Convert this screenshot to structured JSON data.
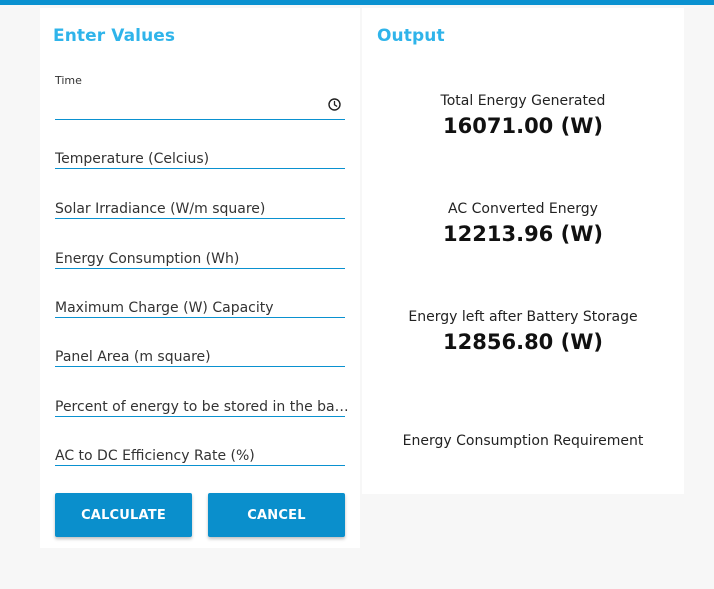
{
  "colors": {
    "accent": "#0a91d0",
    "title": "#2fb4ea",
    "background": "#f7f7f7",
    "card": "#ffffff"
  },
  "input_panel": {
    "title": "Enter Values",
    "time_label": "Time",
    "time_icon": "clock-icon",
    "fields": [
      "Temperature (Celcius)",
      "Solar Irradiance (W/m square)",
      "Energy Consumption (Wh)",
      "Maximum Charge (W) Capacity",
      "Panel Area (m square)",
      "Percent of energy to be stored in the battery",
      "AC to DC Efficiency Rate (%)"
    ],
    "calculate_label": "CALCULATE",
    "cancel_label": "CANCEL"
  },
  "output_panel": {
    "title": "Output",
    "results": [
      {
        "label": "Total Energy Generated",
        "value": "16071.00 (W)"
      },
      {
        "label": "AC Converted Energy",
        "value": "12213.96 (W)"
      },
      {
        "label": "Energy left after Battery Storage",
        "value": "12856.80 (W)"
      },
      {
        "label": "Energy Consumption Requirement",
        "value": ""
      }
    ]
  }
}
